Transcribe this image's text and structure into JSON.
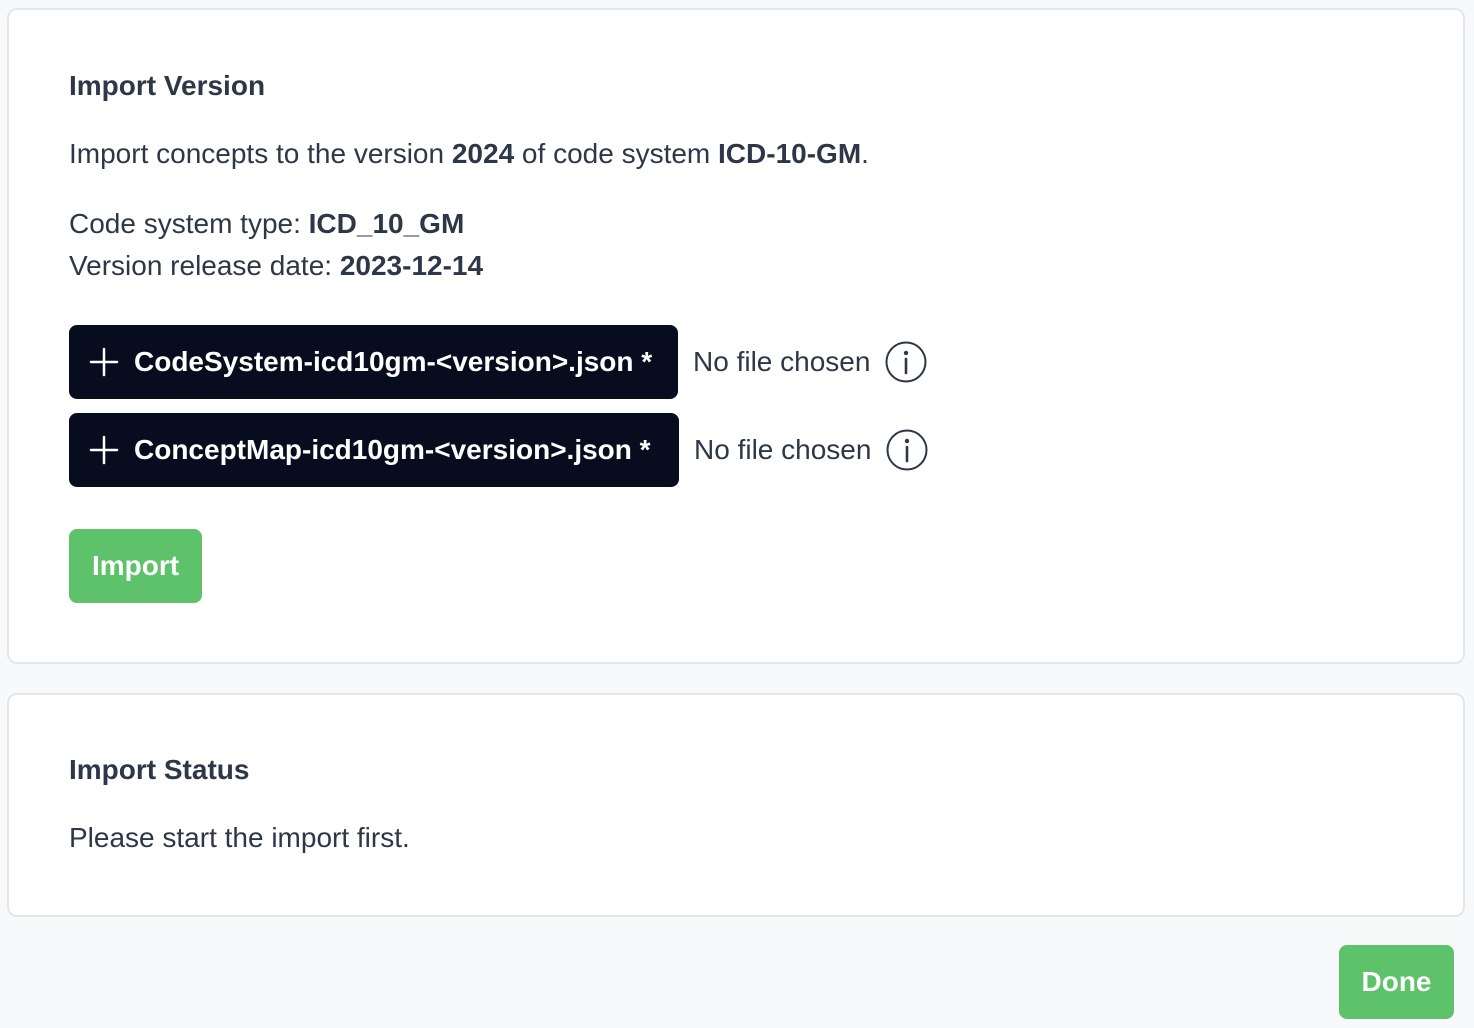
{
  "import_card": {
    "title": "Import Version",
    "intro_prefix": "Import concepts to the version ",
    "version": "2024",
    "intro_middle": " of code system ",
    "code_system": "ICD-10-GM",
    "intro_suffix": ".",
    "type_label": "Code system type: ",
    "type_value": "ICD_10_GM",
    "date_label": "Version release date: ",
    "date_value": "2023-12-14",
    "files": [
      {
        "button_label": "CodeSystem-icd10gm-<version>.json *",
        "status": "No file chosen",
        "icon": "plus-icon",
        "info_icon": "info-icon"
      },
      {
        "button_label": "ConceptMap-icd10gm-<version>.json *",
        "status": "No file chosen",
        "icon": "plus-icon",
        "info_icon": "info-icon"
      }
    ],
    "import_button": "Import"
  },
  "status_card": {
    "title": "Import Status",
    "message": "Please start the import first."
  },
  "footer": {
    "done_button": "Done"
  },
  "colors": {
    "accent_green": "#5ec26a",
    "file_button_bg": "#070d1f",
    "text": "#2d3748",
    "background": "#f8f9fb"
  }
}
